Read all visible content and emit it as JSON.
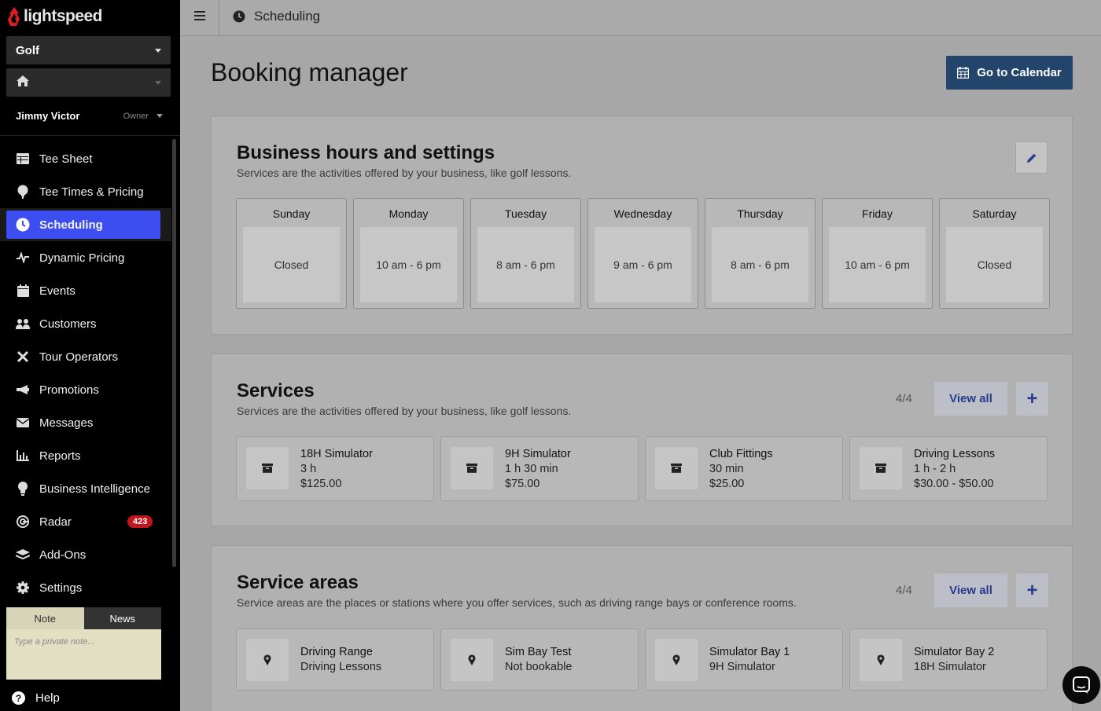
{
  "brand": {
    "name": "lightspeed",
    "accent": "#e11c25"
  },
  "sidebar": {
    "course_selector": "Golf",
    "location_selector_icon": "home-icon",
    "user": {
      "name": "Jimmy Victor",
      "role": "Owner"
    },
    "items": [
      {
        "label": "Tee Sheet",
        "icon": "table-icon"
      },
      {
        "label": "Tee Times & Pricing",
        "icon": "golf-ball-icon"
      },
      {
        "label": "Scheduling",
        "icon": "clock-icon",
        "active": true
      },
      {
        "label": "Dynamic Pricing",
        "icon": "pulse-icon"
      },
      {
        "label": "Events",
        "icon": "calendar-icon"
      },
      {
        "label": "Customers",
        "icon": "users-icon"
      },
      {
        "label": "Tour Operators",
        "icon": "tools-icon"
      },
      {
        "label": "Promotions",
        "icon": "megaphone-icon"
      },
      {
        "label": "Messages",
        "icon": "envelope-icon"
      },
      {
        "label": "Reports",
        "icon": "bar-chart-icon"
      },
      {
        "label": "Business Intelligence",
        "icon": "lightbulb-icon"
      },
      {
        "label": "Radar",
        "icon": "radar-icon",
        "badge": "423"
      },
      {
        "label": "Add-Ons",
        "icon": "layers-icon"
      },
      {
        "label": "Settings",
        "icon": "gear-icon"
      }
    ],
    "note_tabs": {
      "note": "Note",
      "news": "News"
    },
    "note_placeholder": "Type a private note...",
    "help": "Help"
  },
  "topbar": {
    "breadcrumb": "Scheduling"
  },
  "page": {
    "title": "Booking manager",
    "calendar_button": "Go to Calendar"
  },
  "business_hours": {
    "title": "Business hours and settings",
    "subtitle": "Services are the activities offered by your business, like golf lessons.",
    "days": [
      {
        "day": "Sunday",
        "hours": "Closed"
      },
      {
        "day": "Monday",
        "hours": "10 am - 6 pm"
      },
      {
        "day": "Tuesday",
        "hours": "8 am - 6 pm"
      },
      {
        "day": "Wednesday",
        "hours": "9 am - 6 pm"
      },
      {
        "day": "Thursday",
        "hours": "8 am - 6 pm"
      },
      {
        "day": "Friday",
        "hours": "10 am - 6 pm"
      },
      {
        "day": "Saturday",
        "hours": "Closed"
      }
    ]
  },
  "services": {
    "title": "Services",
    "subtitle": "Services are the activities offered by your business, like golf lessons.",
    "count": "4/4",
    "view_all": "View all",
    "add": "+",
    "items": [
      {
        "name": "18H Simulator",
        "duration": "3 h",
        "price": "$125.00"
      },
      {
        "name": "9H Simulator",
        "duration": "1 h 30 min",
        "price": "$75.00"
      },
      {
        "name": "Club Fittings",
        "duration": "30 min",
        "price": "$25.00"
      },
      {
        "name": "Driving Lessons",
        "duration": "1 h - 2 h",
        "price": "$30.00 - $50.00"
      }
    ]
  },
  "service_areas": {
    "title": "Service areas",
    "subtitle": "Service areas are the places or stations where you offer services, such as driving range bays or conference rooms.",
    "count": "4/4",
    "view_all": "View all",
    "add": "+",
    "items": [
      {
        "name": "Driving Range",
        "detail": "Driving Lessons"
      },
      {
        "name": "Sim Bay Test",
        "detail": "Not bookable"
      },
      {
        "name": "Simulator Bay 1",
        "detail": "9H Simulator"
      },
      {
        "name": "Simulator Bay 2",
        "detail": "18H Simulator"
      }
    ]
  }
}
